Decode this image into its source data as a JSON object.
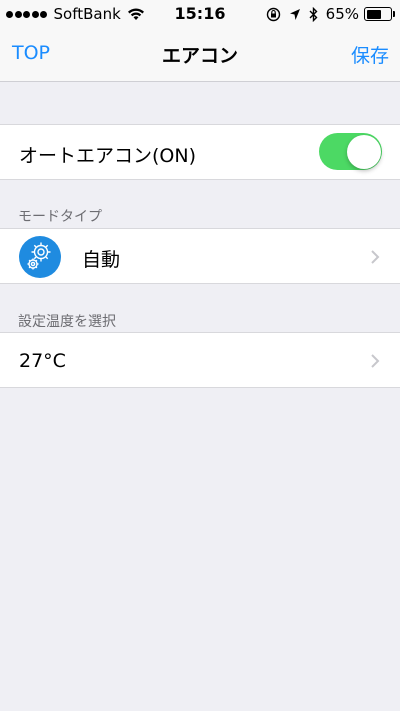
{
  "status_bar": {
    "carrier": "SoftBank",
    "time": "15:16",
    "battery_percent": "65%",
    "battery_level": 0.65,
    "icons": [
      "signal-dots-icon",
      "wifi-icon",
      "orientation-lock-icon",
      "location-arrow-icon",
      "bluetooth-icon",
      "battery-icon"
    ]
  },
  "nav": {
    "back_label": "TOP",
    "title": "エアコン",
    "save_label": "保存"
  },
  "auto_aircon": {
    "label": "オートエアコン(ON)",
    "toggle_on": true
  },
  "mode_section": {
    "header": "モードタイプ",
    "value": "自動",
    "icon": "gear-icon"
  },
  "temp_section": {
    "header": "設定温度を選択",
    "value": "27°C"
  },
  "colors": {
    "accent": "#1a8cff",
    "toggle_on": "#4cd964",
    "gear_badge": "#1f8be0",
    "background": "#efeff4"
  }
}
